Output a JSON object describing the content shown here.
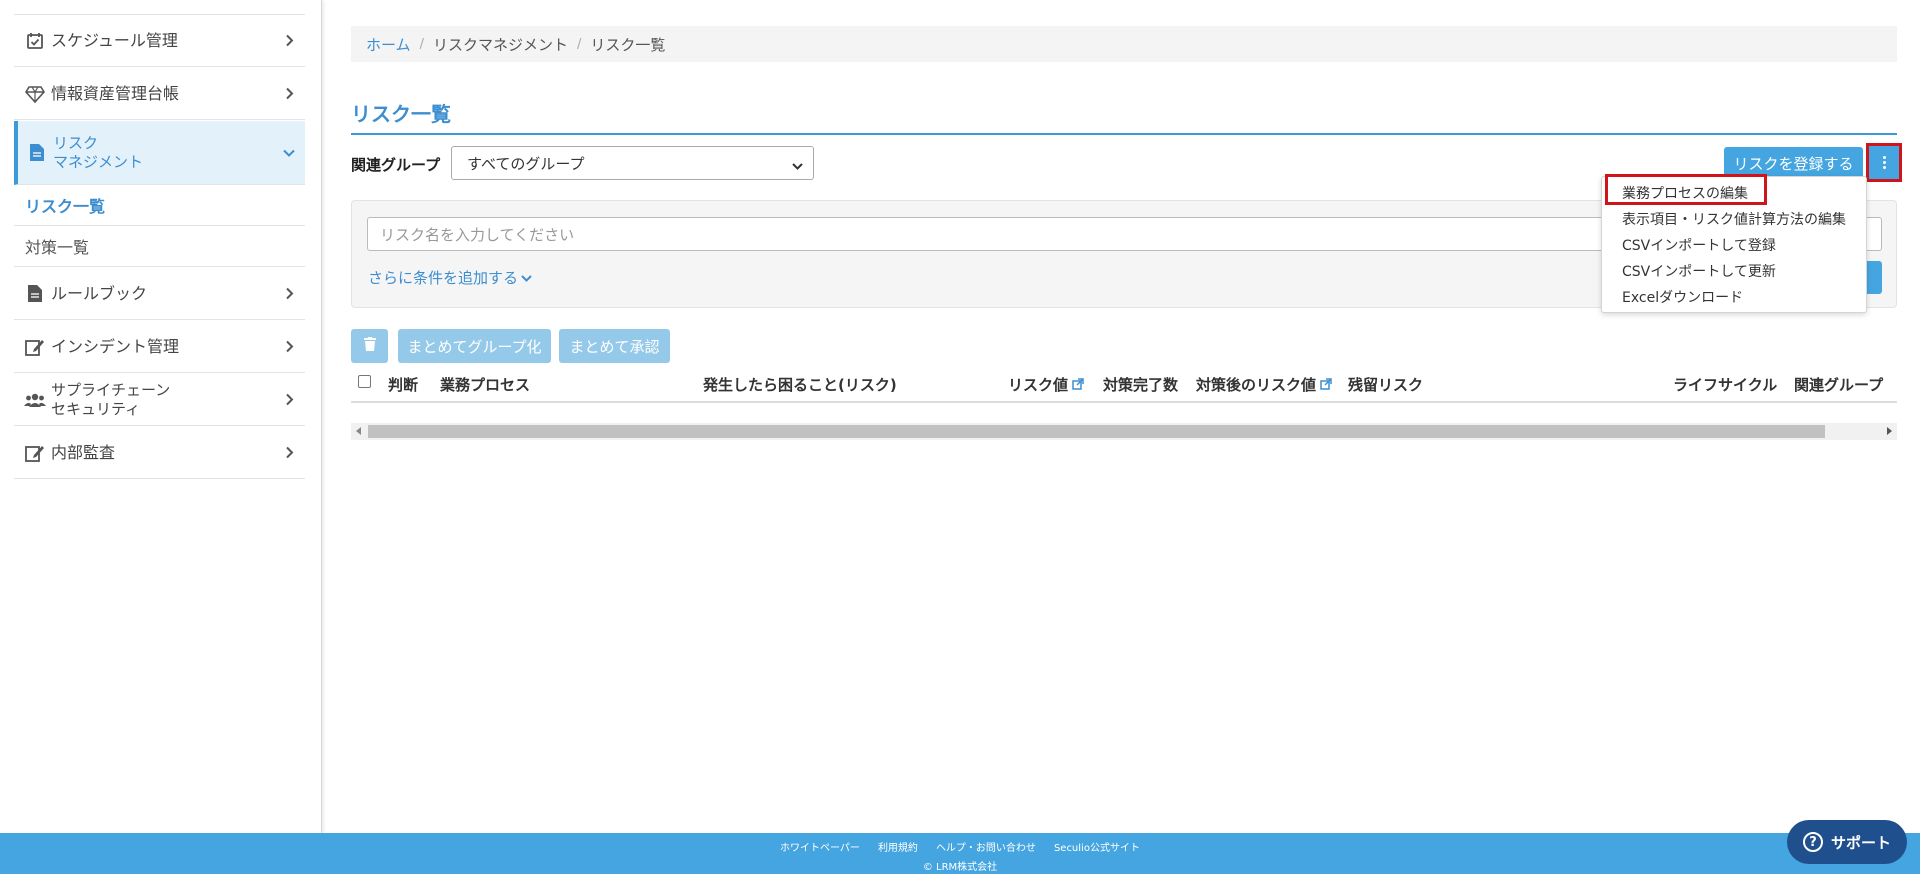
{
  "sidebar": {
    "items": [
      {
        "label": "スケジュール管理",
        "icon": "calendar-check-icon"
      },
      {
        "label": "情報資産管理台帳",
        "icon": "diamond-icon"
      },
      {
        "label_line1": "リスク",
        "label_line2": "マネジメント",
        "icon": "document-icon"
      },
      {
        "label": "ルールブック",
        "icon": "file-icon"
      },
      {
        "label": "インシデント管理",
        "icon": "edit-icon"
      },
      {
        "label_line1": "サプライチェーン",
        "label_line2": "セキュリティ",
        "icon": "users-icon"
      },
      {
        "label": "内部監査",
        "icon": "edit-icon"
      }
    ],
    "sub": {
      "risk_list": "リスク一覧",
      "measure_list": "対策一覧"
    }
  },
  "breadcrumb": {
    "home": "ホーム",
    "risk_management": "リスクマネジメント",
    "current": "リスク一覧"
  },
  "page_title": "リスク一覧",
  "filter": {
    "group_label": "関連グループ",
    "group_value": "すべてのグループ"
  },
  "toolbar": {
    "register": "リスクを登録する"
  },
  "menu": {
    "items": [
      "業務プロセスの編集",
      "表示項目・リスク値計算方法の編集",
      "CSVインポートして登録",
      "CSVインポートして更新",
      "Excelダウンロード"
    ]
  },
  "search": {
    "placeholder": "リスク名を入力してください",
    "more_conditions": "さらに条件を追加する"
  },
  "actions": {
    "group": "まとめてグループ化",
    "approve": "まとめて承認"
  },
  "table": {
    "headers": [
      "判断",
      "業務プロセス",
      "発生したら困ること(リスク)",
      "リスク値",
      "対策完了数",
      "対策後のリスク値",
      "残留リスク",
      "ライフサイクル",
      "関連グループ"
    ]
  },
  "footer": {
    "links": [
      "ホワイトペーパー",
      "利用規約",
      "ヘルプ・お問い合わせ",
      "Seculio公式サイト"
    ],
    "copyright": "© LRM株式会社",
    "support": "サポート"
  },
  "colors": {
    "accent": "#3d8ed0",
    "primary": "#45a5e0",
    "highlight": "#d0141b"
  }
}
